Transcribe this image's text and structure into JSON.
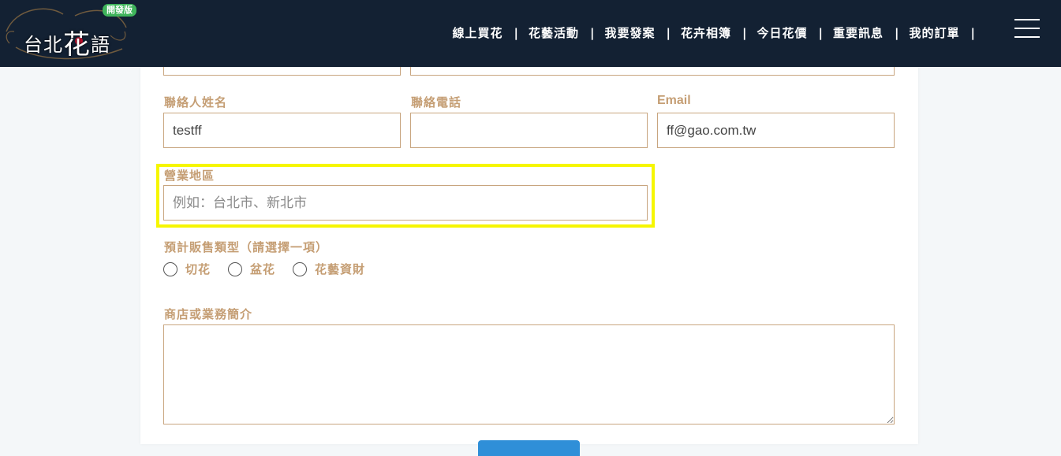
{
  "header": {
    "logo_text_small": "台北",
    "logo_text_big": "花",
    "logo_text_end": "語",
    "badge": "開發版",
    "nav": [
      {
        "label": "線上買花"
      },
      {
        "label": "花藝活動"
      },
      {
        "label": "我要發案"
      },
      {
        "label": "花卉相簿"
      },
      {
        "label": "今日花價"
      },
      {
        "label": "重要訊息"
      },
      {
        "label": "我的訂單"
      }
    ],
    "separator": "|"
  },
  "form": {
    "contact_name": {
      "label": "聯絡人姓名",
      "value": "testff"
    },
    "contact_phone": {
      "label": "聯絡電話",
      "value": ""
    },
    "email": {
      "label": "Email",
      "value": "ff@gao.com.tw"
    },
    "region": {
      "label": "營業地區",
      "placeholder": "例如：台北市、新北市",
      "value": ""
    },
    "sales_type": {
      "label": "預計販售類型（請選擇一項）",
      "options": [
        "切花",
        "盆花",
        "花藝資財"
      ]
    },
    "intro": {
      "label": "商店或業務簡介",
      "value": ""
    }
  },
  "colors": {
    "header_bg": "#132133",
    "label": "#c59e74",
    "input_border": "#c8a57f",
    "highlight": "#f6f600",
    "badge": "#3fb45b",
    "button": "#2f8fd8"
  }
}
